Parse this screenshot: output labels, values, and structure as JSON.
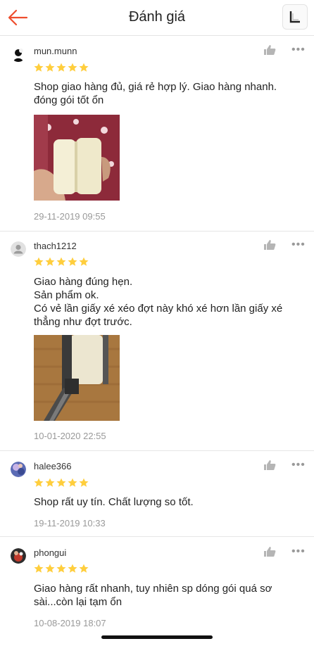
{
  "header": {
    "title": "Đánh giá"
  },
  "colors": {
    "accent": "#ee4d2d",
    "star": "#ffce3d"
  },
  "reviews": [
    {
      "username": "mun.munn",
      "rating": 5,
      "lines": [
        "Shop giao hàng đủ, giá rẻ hợp lý. Giao hàng nhanh.",
        "đóng gói tốt ổn"
      ],
      "date": "29-11-2019 09:55"
    },
    {
      "username": "thach1212",
      "rating": 5,
      "lines": [
        "Giao hàng đúng hẹn.",
        "Sản phẩm ok.",
        "Có vẻ lần giấy xé xéo đợt này khó xé hơn lần giấy xé",
        "thẳng như đợt trước."
      ],
      "date": "10-01-2020 22:55"
    },
    {
      "username": "halee366",
      "rating": 5,
      "lines": [
        "Shop rất uy tín. Chất lượng so tốt."
      ],
      "date": "19-11-2019 10:33"
    },
    {
      "username": "phongui",
      "rating": 5,
      "lines": [
        "Giao hàng rất nhanh, tuy nhiên sp dóng gói quá sơ",
        "sài...còn lại tạm ổn"
      ],
      "date": "10-08-2019 18:07"
    }
  ]
}
